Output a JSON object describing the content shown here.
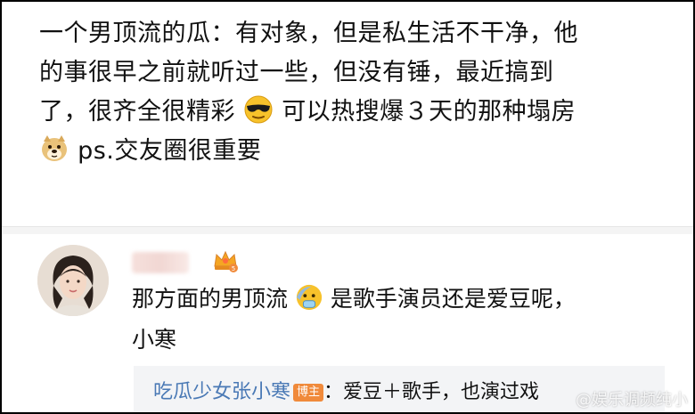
{
  "post": {
    "lines": [
      "一个男顶流的瓜：有对象，但是私生活不干净，他",
      "的事很早之前就听过一些，但没有锤，最近搞到",
      "了，很齐全很精彩",
      "可以热搜爆３天的那种塌房",
      "ps.交友圈很重要"
    ],
    "emoji_1": "sunglasses-emoji",
    "emoji_2": "doge-emoji"
  },
  "comment": {
    "avatar": "avatar",
    "crown_level": "5",
    "text_part1": "那方面的男顶流",
    "emoji": "cold-sweat-emoji",
    "text_part2": "是歌手演员还是爱豆呢，",
    "text_line2": "小寒"
  },
  "reply": {
    "username": "吃瓜少女张小寒",
    "badge": "博主",
    "text": "：爱豆＋歌手，也演过戏"
  },
  "watermark": "@娱乐调频纯小"
}
